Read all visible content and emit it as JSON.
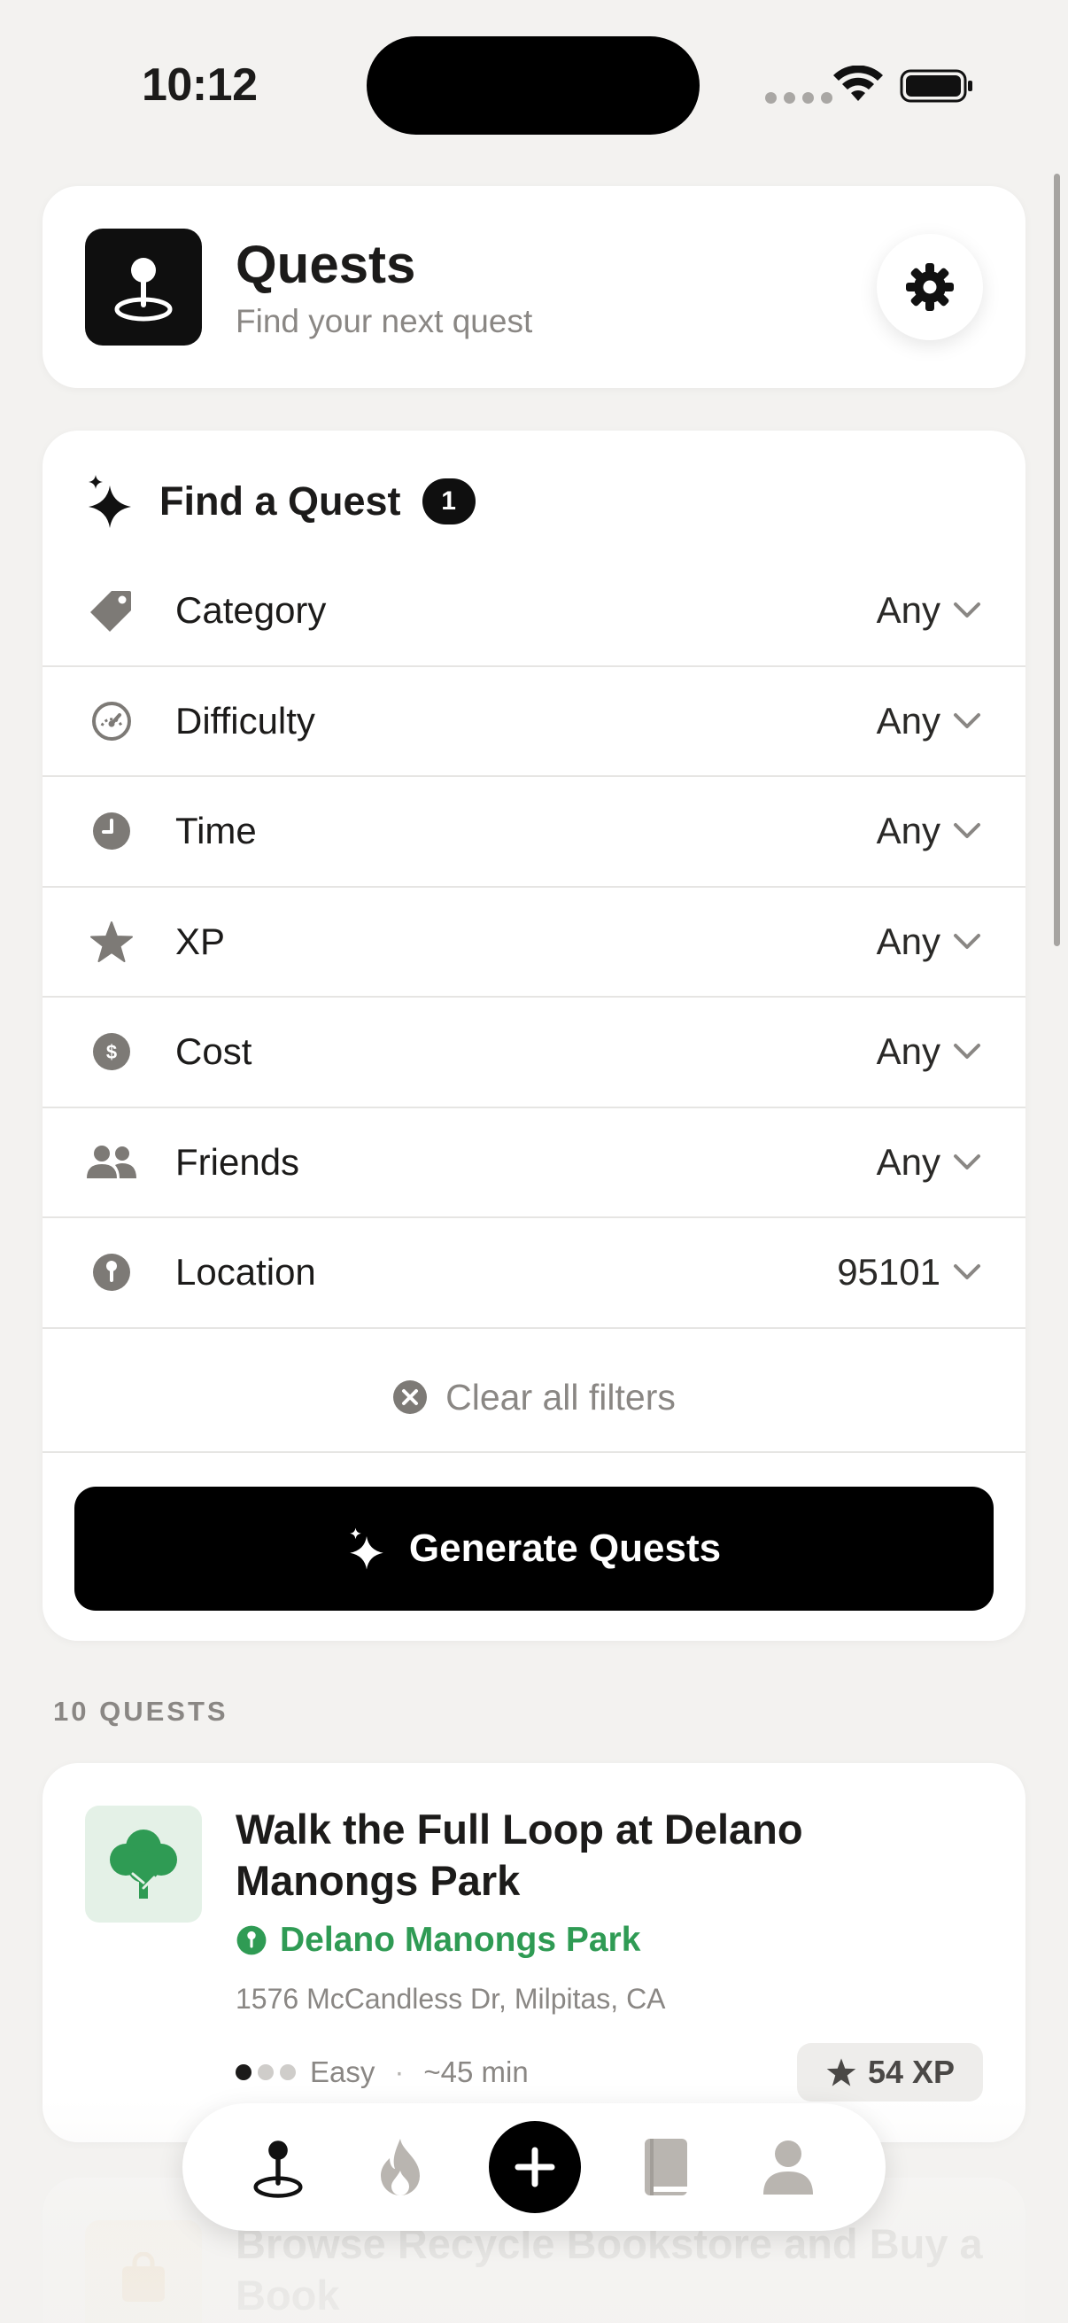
{
  "status_bar": {
    "time": "10:12"
  },
  "header": {
    "title": "Quests",
    "subtitle": "Find your next quest",
    "logo_icon": "map-pin-icon",
    "settings_icon": "gear-icon"
  },
  "finder": {
    "title": "Find a Quest",
    "badge": "1",
    "filters": [
      {
        "label": "Category",
        "value": "Any",
        "icon": "tag-icon"
      },
      {
        "label": "Difficulty",
        "value": "Any",
        "icon": "gauge-icon"
      },
      {
        "label": "Time",
        "value": "Any",
        "icon": "clock-icon"
      },
      {
        "label": "XP",
        "value": "Any",
        "icon": "star-icon"
      },
      {
        "label": "Cost",
        "value": "Any",
        "icon": "dollar-icon"
      },
      {
        "label": "Friends",
        "value": "Any",
        "icon": "people-icon"
      },
      {
        "label": "Location",
        "value": "95101",
        "icon": "location-pin-icon"
      }
    ],
    "clear_label": "Clear all filters",
    "generate_label": "Generate Quests"
  },
  "results": {
    "count_label": "10 QUESTS",
    "quests": [
      {
        "title": "Walk the Full Loop at Delano Manongs Park",
        "place": "Delano Manongs Park",
        "address": "1576 McCandless Dr, Milpitas, CA",
        "difficulty": "Easy",
        "difficulty_level": 1,
        "difficulty_max": 3,
        "duration": "~45 min",
        "xp": "54 XP",
        "icon": "tree-icon"
      },
      {
        "title": "Browse Recycle Bookstore and Buy a Book",
        "icon": "shopping-bag-icon"
      }
    ]
  },
  "tab_bar": {
    "tabs": [
      {
        "name": "quests",
        "icon": "map-pin-icon"
      },
      {
        "name": "streaks",
        "icon": "flame-icon"
      },
      {
        "name": "add",
        "icon": "plus-icon"
      },
      {
        "name": "journal",
        "icon": "book-icon"
      },
      {
        "name": "profile",
        "icon": "person-icon"
      }
    ]
  },
  "colors": {
    "background": "#f3f2f0",
    "accent": "#000000",
    "place_green": "#2f9b54",
    "muted_text": "#8a8784",
    "icon_gray": "#7d7a76"
  }
}
